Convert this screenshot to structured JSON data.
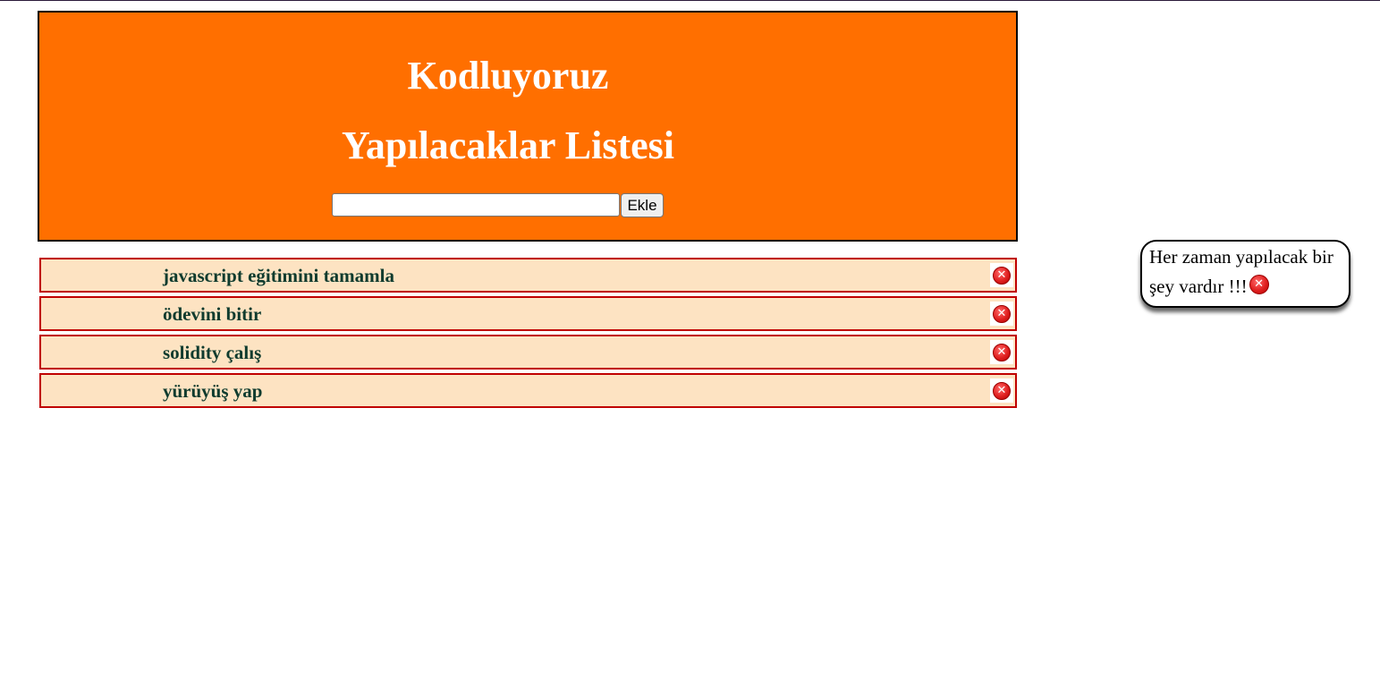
{
  "header": {
    "site_title": "Kodluyoruz",
    "list_title": "Yapılacaklar Listesi",
    "input_value": "",
    "add_button_label": "Ekle"
  },
  "todos": [
    {
      "text": "javascript eğitimini tamamla"
    },
    {
      "text": "ödevini bitir"
    },
    {
      "text": "solidity çalış"
    },
    {
      "text": "yürüyüş yap"
    }
  ],
  "note": {
    "text": "Her zaman yapılacak bir şey vardır !!!"
  },
  "icons": {
    "close": "close-icon"
  },
  "colors": {
    "header_bg": "#ff6f00",
    "item_bg": "#fde3c2",
    "item_border": "#c00000",
    "item_text": "#0f3b2e"
  }
}
